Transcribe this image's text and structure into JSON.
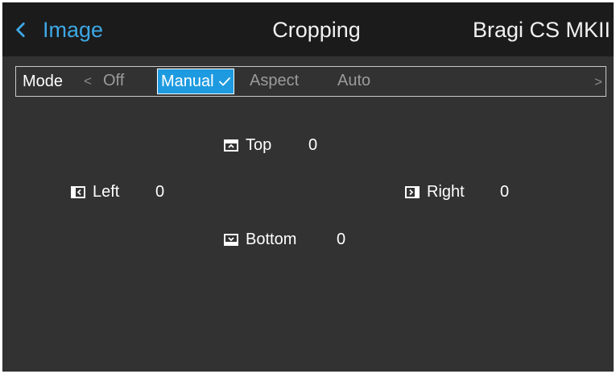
{
  "header": {
    "back_label": "Image",
    "title": "Cropping",
    "device": "Bragi CS MKII"
  },
  "mode": {
    "label": "Mode",
    "options": [
      "Off",
      "Manual",
      "Aspect",
      "Auto"
    ],
    "selected": "Manual"
  },
  "crop": {
    "top": {
      "label": "Top",
      "value": "0"
    },
    "left": {
      "label": "Left",
      "value": "0"
    },
    "right": {
      "label": "Right",
      "value": "0"
    },
    "bottom": {
      "label": "Bottom",
      "value": "0"
    }
  },
  "colors": {
    "accent": "#1e9be0",
    "link": "#3ea8e5",
    "background": "#323232",
    "header_background": "#1b1b1b"
  },
  "icons": [
    "chevron-left-icon",
    "checkmark-icon",
    "crop-top-icon",
    "crop-left-icon",
    "crop-right-icon",
    "crop-bottom-icon",
    "chevron-right-icon"
  ]
}
